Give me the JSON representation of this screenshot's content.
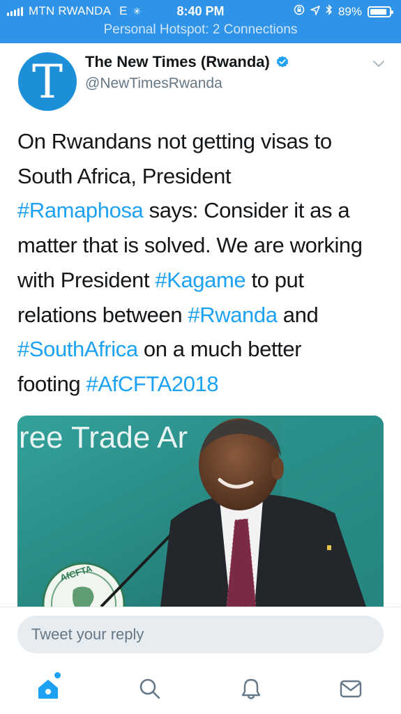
{
  "status_bar": {
    "carrier": "MTN RWANDA",
    "network": "E",
    "time": "8:40 PM",
    "battery_percent": "89%",
    "battery_level": 0.89,
    "hotspot": "Personal Hotspot: 2 Connections",
    "color": "#2f93e8"
  },
  "tweet": {
    "display_name": "The New Times (Rwanda)",
    "handle": "@NewTimesRwanda",
    "avatar_letter": "T",
    "verified_icon": "verified-badge-icon",
    "text_lines": [
      [
        {
          "t": "On Rwandans not getting visas to",
          "tag": false
        }
      ],
      [
        {
          "t": "South Africa, President",
          "tag": false
        }
      ],
      [
        {
          "t": "#Ramaphosa",
          "tag": true
        },
        {
          "t": " says: Consider it as a",
          "tag": false
        }
      ],
      [
        {
          "t": "matter that is solved. We are working",
          "tag": false
        }
      ],
      [
        {
          "t": "with President ",
          "tag": false
        },
        {
          "t": "#Kagame",
          "tag": true
        },
        {
          "t": " to put",
          "tag": false
        }
      ],
      [
        {
          "t": "relations between ",
          "tag": false
        },
        {
          "t": "#Rwanda",
          "tag": true
        },
        {
          "t": " and",
          "tag": false
        }
      ],
      [
        {
          "t": "#SouthAfrica",
          "tag": true
        },
        {
          "t": " on a much better",
          "tag": false
        }
      ],
      [
        {
          "t": "footing ",
          "tag": false
        },
        {
          "t": "#AfCFTA2018",
          "tag": true
        }
      ]
    ],
    "hashtag_color": "#1da1f2"
  },
  "media": {
    "banner_text": "ree Trade Ar",
    "logo_text": "AfCFTA"
  },
  "reply": {
    "placeholder": "Tweet your reply"
  },
  "tab_bar": {
    "tabs": [
      {
        "name": "home-icon",
        "active": true
      },
      {
        "name": "search-icon",
        "active": false
      },
      {
        "name": "notifications-icon",
        "active": false
      },
      {
        "name": "messages-icon",
        "active": false
      }
    ]
  }
}
